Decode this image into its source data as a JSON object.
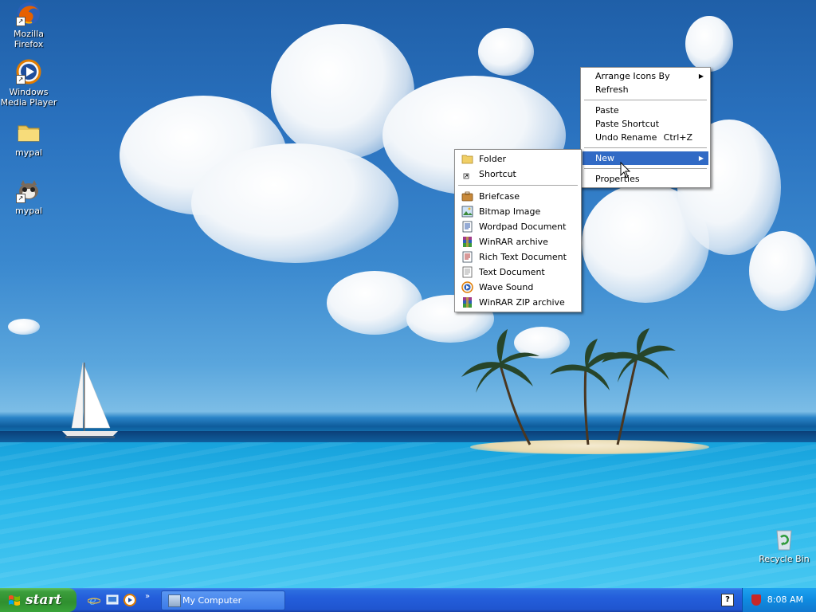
{
  "desktop_icons": [
    {
      "label": "Mozilla Firefox",
      "icon": "firefox-icon"
    },
    {
      "label": "Windows Media Player",
      "icon": "media-player-icon"
    },
    {
      "label": "mypal",
      "icon": "folder-icon"
    },
    {
      "label": "mypal",
      "icon": "mypal-app-icon"
    },
    {
      "label": "Recycle Bin",
      "icon": "recycle-bin-icon"
    }
  ],
  "context_menu": {
    "items": {
      "arrange": "Arrange Icons By",
      "refresh": "Refresh",
      "paste": "Paste",
      "paste_shortcut": "Paste Shortcut",
      "undo_rename": "Undo Rename",
      "undo_shortcut": "Ctrl+Z",
      "new": "New",
      "properties": "Properties"
    },
    "submenu_arrow": "▶"
  },
  "new_submenu": {
    "items": [
      {
        "label": "Folder",
        "icon": "folder-icon"
      },
      {
        "label": "Shortcut",
        "icon": "shortcut-icon"
      },
      {
        "label": "Briefcase",
        "icon": "briefcase-icon"
      },
      {
        "label": "Bitmap Image",
        "icon": "bitmap-icon"
      },
      {
        "label": "Wordpad Document",
        "icon": "wordpad-icon"
      },
      {
        "label": "WinRAR archive",
        "icon": "winrar-icon"
      },
      {
        "label": "Rich Text Document",
        "icon": "rtf-icon"
      },
      {
        "label": "Text Document",
        "icon": "text-document-icon"
      },
      {
        "label": "Wave Sound",
        "icon": "wave-sound-icon"
      },
      {
        "label": "WinRAR ZIP archive",
        "icon": "winrar-zip-icon"
      }
    ]
  },
  "taskbar": {
    "start_label": "start",
    "quick_launch_chevron": "»",
    "task_button": "My Computer",
    "help_glyph": "?",
    "clock": "8:08 AM"
  },
  "colors": {
    "menu_highlight": "#316ac5",
    "taskbar_blue": "#245edb",
    "start_green": "#3c9e3c"
  }
}
